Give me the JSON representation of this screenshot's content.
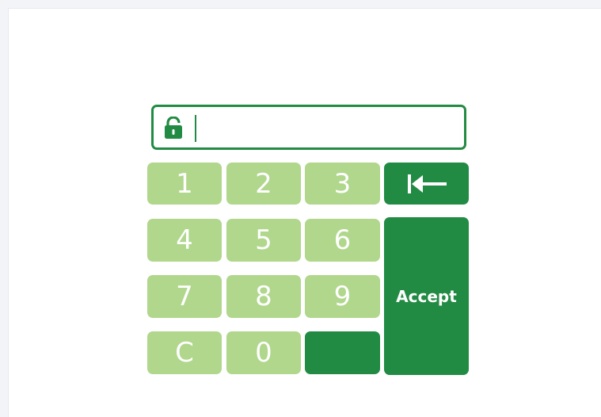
{
  "keypad": {
    "keys": [
      "1",
      "2",
      "3",
      "4",
      "5",
      "6",
      "7",
      "8",
      "9",
      "C",
      "0"
    ],
    "accept_label": "Accept"
  },
  "pin_field": {
    "value": ""
  },
  "icons": {
    "lock": "unlock-icon",
    "backspace": "backspace-icon"
  },
  "colors": {
    "accent": "#228b43",
    "digit_key": "#b0d78c",
    "key_text": "#ffffff"
  }
}
